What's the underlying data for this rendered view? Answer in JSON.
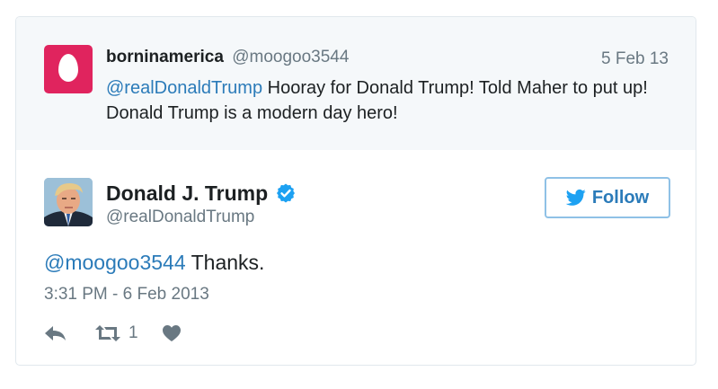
{
  "parent_tweet": {
    "author_name": "borninamerica",
    "author_handle": "@moogoo3544",
    "date": "5 Feb 13",
    "mention": "@realDonaldTrump",
    "text": " Hooray for Donald Trump! Told Maher to put up! Donald Trump is a modern day hero!",
    "avatar_color": "#e0245e"
  },
  "tweet": {
    "author_name": "Donald J. Trump",
    "author_handle": "@realDonaldTrump",
    "verified_icon": "verified-badge-icon",
    "follow_label": "Follow",
    "mention": "@moogoo3544",
    "text": " Thanks.",
    "timestamp": "3:31 PM - 6 Feb 2013",
    "retweet_count": "1"
  },
  "colors": {
    "link": "#2b7bb9",
    "muted": "#697882",
    "verified": "#1da1f2",
    "parent_background": "#f5f8fa"
  }
}
